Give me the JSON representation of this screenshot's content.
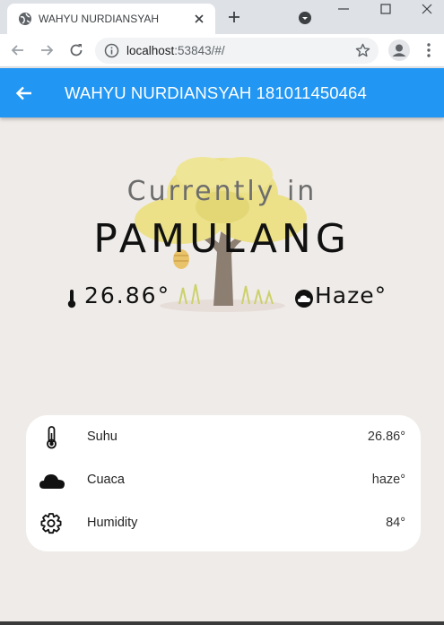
{
  "browser": {
    "tab_title": "WAHYU NURDIANSYAH",
    "url_host": "localhost",
    "url_rest": ":53843/#/"
  },
  "appbar": {
    "title": "WAHYU NURDIANSYAH 181011450464"
  },
  "hero": {
    "currently": "Currently in",
    "city": "PAMULANG",
    "temperature": "26.86°",
    "condition": "Haze°"
  },
  "details": [
    {
      "icon": "thermometer-icon",
      "label": "Suhu",
      "value": "26.86°"
    },
    {
      "icon": "cloud-icon",
      "label": "Cuaca",
      "value": "haze°"
    },
    {
      "icon": "gear-icon",
      "label": "Humidity",
      "value": "84°"
    }
  ],
  "colors": {
    "appbar": "#2196f3",
    "background": "#efebe8",
    "card": "#ffffff"
  }
}
